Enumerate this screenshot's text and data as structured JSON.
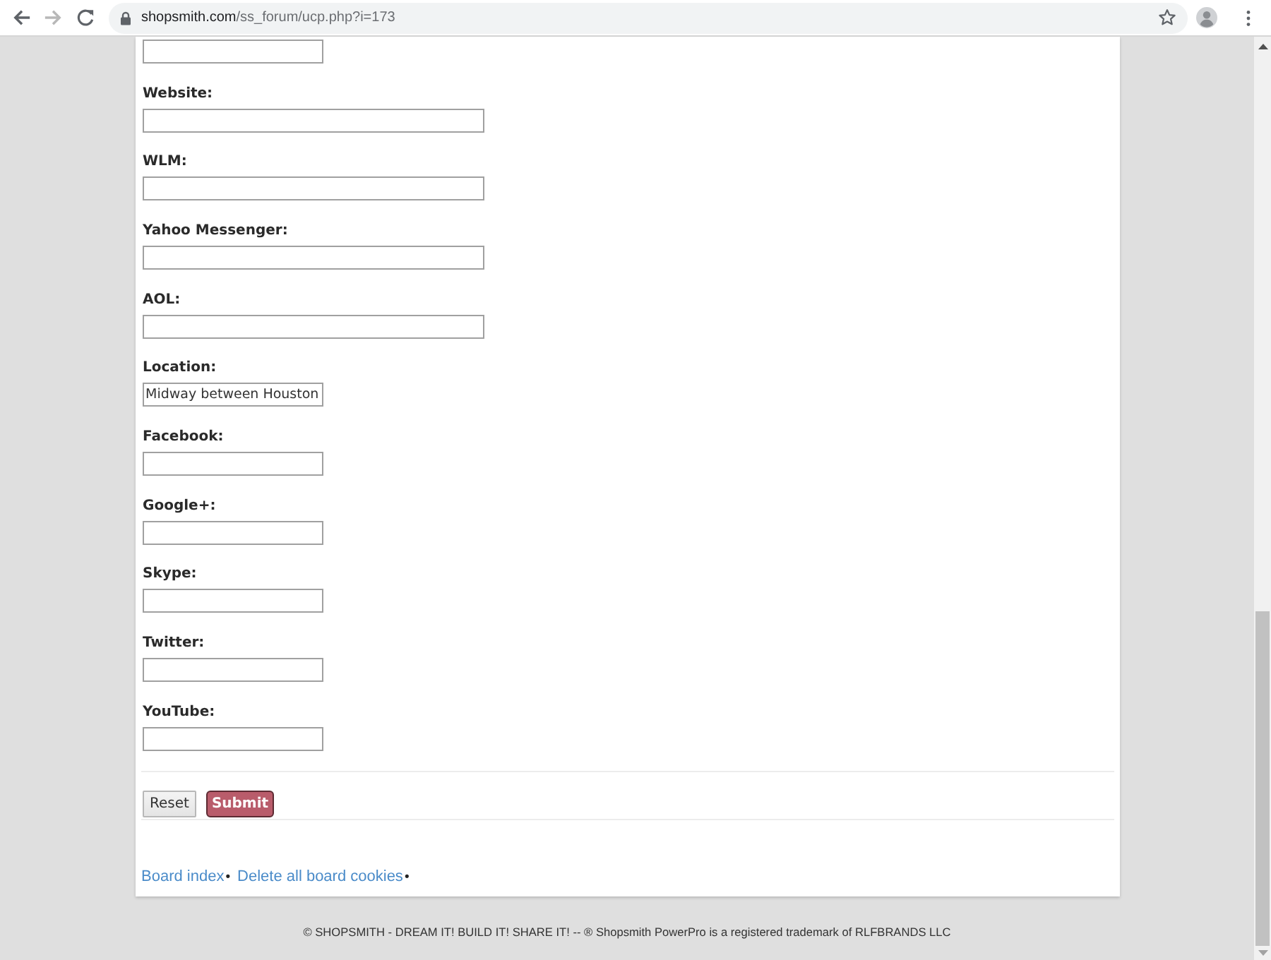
{
  "browser": {
    "url_host": "shopsmith.com",
    "url_path": "/ss_forum/ucp.php?i=173"
  },
  "fields": [
    {
      "kind": "narrow"
    },
    {
      "label": "Website:",
      "kind": "wide"
    },
    {
      "label": "WLM:",
      "kind": "wide"
    },
    {
      "label": "Yahoo Messenger:",
      "kind": "wide"
    },
    {
      "label": "AOL:",
      "kind": "wide"
    },
    {
      "label": "Location:",
      "kind": "narrow",
      "value": "Midway between Houston"
    },
    {
      "label": "Facebook:",
      "kind": "narrow"
    },
    {
      "label": "Google+:",
      "kind": "narrow"
    },
    {
      "label": "Skype:",
      "kind": "narrow"
    },
    {
      "label": "Twitter:",
      "kind": "narrow"
    },
    {
      "label": "YouTube:",
      "kind": "narrow"
    }
  ],
  "buttons": [
    {
      "label": "Reset",
      "kind": "reset"
    },
    {
      "label": "Submit",
      "kind": "submit"
    }
  ],
  "nav": [
    {
      "text": "Board index",
      "kind": "link"
    },
    {
      "text": "•",
      "kind": "separator"
    },
    {
      "text": "Delete all board cookies",
      "kind": "link"
    },
    {
      "text": "•",
      "kind": "separator"
    }
  ],
  "footer": "© SHOPSMITH - DREAM IT! BUILD IT! SHARE IT! -- ® Shopsmith PowerPro is a registered trademark of RLFBRANDS LLC"
}
